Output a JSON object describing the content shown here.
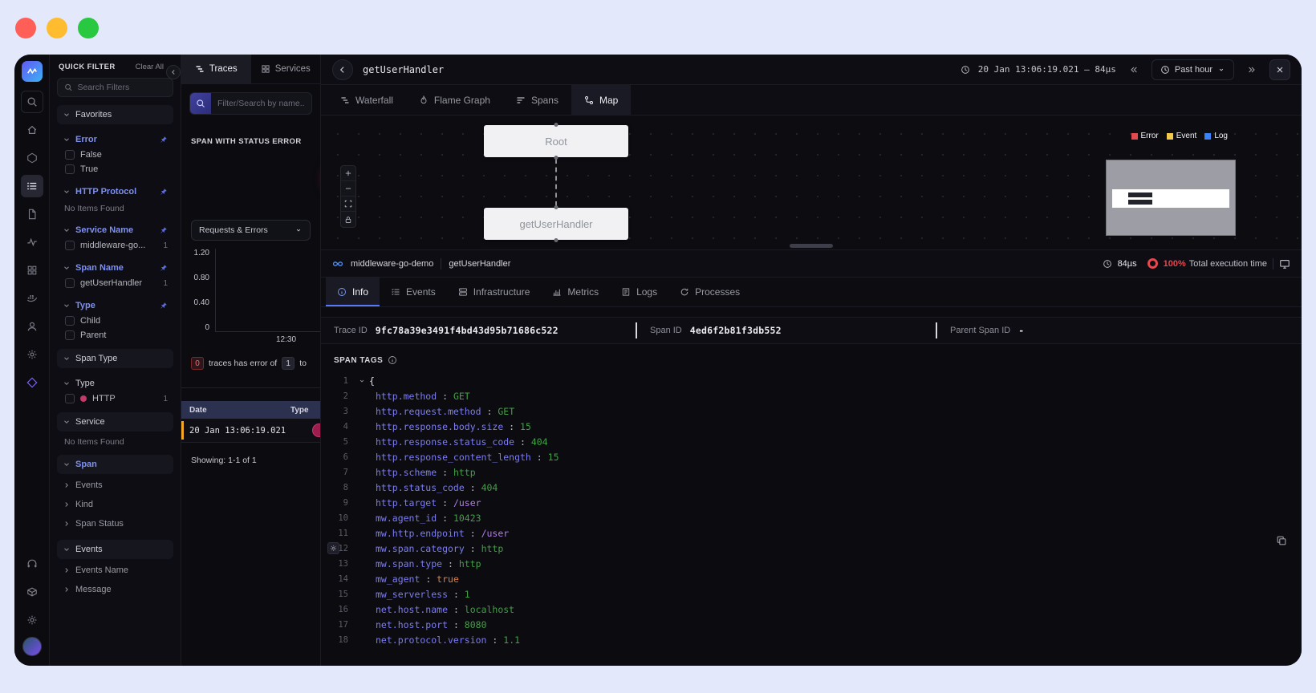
{
  "qf": {
    "title": "QUICK FILTER",
    "clear": "Clear All",
    "search_ph": "Search Filters",
    "favorites": "Favorites",
    "error": "Error",
    "opt_false": "False",
    "opt_true": "True",
    "http_protocol": "HTTP Protocol",
    "no_items": "No Items Found",
    "service_name": "Service Name",
    "mw_opt": "middleware-go...",
    "mw_count": "1",
    "span_name": "Span Name",
    "guh_opt": "getUserHandler",
    "guh_count": "1",
    "type": "Type",
    "child": "Child",
    "parent": "Parent",
    "span_type": "Span Type",
    "type2": "Type",
    "http": "HTTP",
    "http_count": "1",
    "service": "Service",
    "no_items2": "No Items Found",
    "span": "Span",
    "events_collapsed": "Events",
    "kind": "Kind",
    "span_status": "Span Status",
    "events": "Events",
    "events_name": "Events Name",
    "message": "Message"
  },
  "mid": {
    "tab_traces": "Traces",
    "tab_services": "Services",
    "filter_ph": "Filter/Search by name...",
    "error_title": "SPAN WITH STATUS ERROR",
    "error_count": "0",
    "select": "Requests & Errors",
    "y_ticks": [
      "1.20",
      "0.80",
      "0.40",
      "0"
    ],
    "x_tick": "12:30",
    "sum_badge1": "0",
    "sum_text": "traces has error of",
    "sum_badge2": "1",
    "sum_tail": "to",
    "col_date": "Date",
    "col_type": "Type",
    "row_date": "20 Jan 13:06:19.021",
    "showing": "Showing: 1-1 of 1"
  },
  "hdr": {
    "title": "getUserHandler",
    "timestamp": "20 Jan 13:06:19.021 – 84µs",
    "range": "Past hour"
  },
  "views": {
    "waterfall": "Waterfall",
    "flame": "Flame Graph",
    "spans": "Spans",
    "map": "Map"
  },
  "map": {
    "root": "Root",
    "child": "getUserHandler",
    "legend": [
      {
        "label": "Error",
        "color": "#e5484d"
      },
      {
        "label": "Event",
        "color": "#f2c94c"
      },
      {
        "label": "Log",
        "color": "#3b82f6"
      }
    ]
  },
  "crumb": {
    "service": "middleware-go-demo",
    "span": "getUserHandler",
    "duration": "84µs",
    "pct": "100%",
    "pct_label": "Total execution time"
  },
  "tabs": {
    "info": "Info",
    "events": "Events",
    "infra": "Infrastructure",
    "metrics": "Metrics",
    "logs": "Logs",
    "processes": "Processes"
  },
  "ids": {
    "trace_label": "Trace ID",
    "trace": "9fc78a39e3491f4bd43d95b71686c522",
    "span_label": "Span ID",
    "span": "4ed6f2b81f3db552",
    "parent_label": "Parent Span ID",
    "parent": "-"
  },
  "tags": {
    "title": "SPAN TAGS",
    "line1": "1",
    "open_brace": "{",
    "colon": " : ",
    "lines": [
      {
        "n": "2",
        "k": "http.method",
        "v": "GET",
        "t": "str"
      },
      {
        "n": "3",
        "k": "http.request.method",
        "v": "GET",
        "t": "str"
      },
      {
        "n": "4",
        "k": "http.response.body.size",
        "v": "15",
        "t": "num"
      },
      {
        "n": "5",
        "k": "http.response.status_code",
        "v": "404",
        "t": "num"
      },
      {
        "n": "6",
        "k": "http.response_content_length",
        "v": "15",
        "t": "num"
      },
      {
        "n": "7",
        "k": "http.scheme",
        "v": "http",
        "t": "str"
      },
      {
        "n": "8",
        "k": "http.status_code",
        "v": "404",
        "t": "num"
      },
      {
        "n": "9",
        "k": "http.target",
        "v": "/user",
        "t": "path"
      },
      {
        "n": "10",
        "k": "mw.agent_id",
        "v": "10423",
        "t": "num"
      },
      {
        "n": "11",
        "k": "mw.http.endpoint",
        "v": "/user",
        "t": "path"
      },
      {
        "n": "12",
        "k": "mw.span.category",
        "v": "http",
        "t": "str"
      },
      {
        "n": "13",
        "k": "mw.span.type",
        "v": "http",
        "t": "str"
      },
      {
        "n": "14",
        "k": "mw_agent",
        "v": "true",
        "t": "bool"
      },
      {
        "n": "15",
        "k": "mw_serverless",
        "v": "1",
        "t": "num"
      },
      {
        "n": "16",
        "k": "net.host.name",
        "v": "localhost",
        "t": "str"
      },
      {
        "n": "17",
        "k": "net.host.port",
        "v": "8080",
        "t": "num"
      },
      {
        "n": "18",
        "k": "net.protocol.version",
        "v": "1.1",
        "t": "num"
      }
    ]
  }
}
